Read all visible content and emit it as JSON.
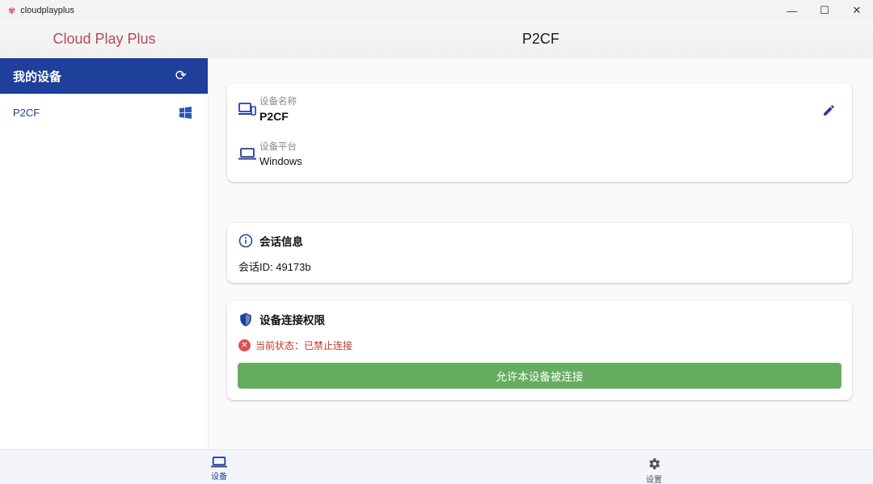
{
  "window": {
    "title": "cloudplayplus",
    "controls": {
      "minimize": "—",
      "maximize": "☐",
      "close": "✕"
    }
  },
  "header": {
    "brand": "Cloud Play Plus",
    "page_title": "P2CF"
  },
  "sidebar": {
    "heading": "我的设备",
    "refresh_icon": "refresh-icon",
    "devices": [
      {
        "name": "P2CF",
        "platform_icon": "windows-icon"
      }
    ]
  },
  "device_info": {
    "name_label": "设备名称",
    "name_value": "P2CF",
    "platform_label": "设备平台",
    "platform_value": "Windows"
  },
  "session": {
    "heading": "会话信息",
    "session_id": "会话ID: 49173b"
  },
  "permission": {
    "heading": "设备连接权限",
    "status": "当前状态：已禁止连接",
    "button_label": "允许本设备被连接"
  },
  "bottom_nav": {
    "devices_label": "设备",
    "settings_label": "设置"
  },
  "colors": {
    "accent": "#1e3f9a",
    "brand": "#b54a5a",
    "success": "#65ad5f",
    "danger": "#d9534f"
  }
}
